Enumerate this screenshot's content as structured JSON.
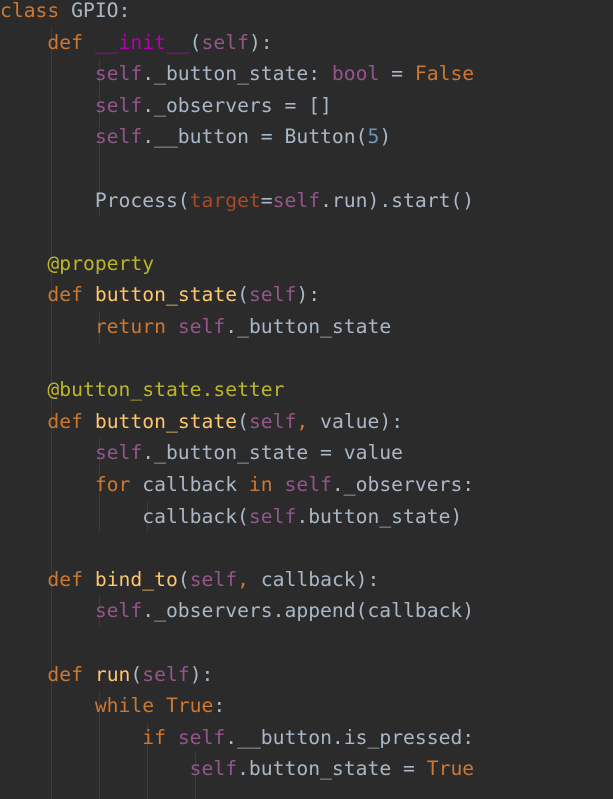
{
  "colors": {
    "background": "#2b2b2b",
    "keyword": "#cc7832",
    "self": "#94558d",
    "function": "#ffc66d",
    "dunder": "#b200b2",
    "decorator": "#bbb529",
    "number": "#6897bb",
    "named_param": "#aa4926",
    "text": "#a9b7c6",
    "indent_guide": "#3b3b3b"
  },
  "lines": [
    [
      [
        "kw",
        "class"
      ],
      [
        "plain",
        " GPIO:"
      ]
    ],
    [
      [
        "plain",
        "    "
      ],
      [
        "kw",
        "def"
      ],
      [
        "plain",
        " "
      ],
      [
        "dunder",
        "__init__"
      ],
      [
        "plain",
        "("
      ],
      [
        "self",
        "self"
      ],
      [
        "plain",
        "):"
      ]
    ],
    [
      [
        "plain",
        "        "
      ],
      [
        "self",
        "self"
      ],
      [
        "plain",
        "._button_state: "
      ],
      [
        "self",
        "bool"
      ],
      [
        "plain",
        " = "
      ],
      [
        "kw",
        "False"
      ]
    ],
    [
      [
        "plain",
        "        "
      ],
      [
        "self",
        "self"
      ],
      [
        "plain",
        "._observers = []"
      ]
    ],
    [
      [
        "plain",
        "        "
      ],
      [
        "self",
        "self"
      ],
      [
        "plain",
        ".__button = Button("
      ],
      [
        "num",
        "5"
      ],
      [
        "plain",
        ")"
      ]
    ],
    [],
    [
      [
        "plain",
        "        Process("
      ],
      [
        "param",
        "target"
      ],
      [
        "plain",
        "="
      ],
      [
        "self",
        "self"
      ],
      [
        "plain",
        ".run).start()"
      ]
    ],
    [],
    [
      [
        "plain",
        "    "
      ],
      [
        "dec",
        "@property"
      ]
    ],
    [
      [
        "plain",
        "    "
      ],
      [
        "kw",
        "def"
      ],
      [
        "plain",
        " "
      ],
      [
        "fn",
        "button_state"
      ],
      [
        "plain",
        "("
      ],
      [
        "self",
        "self"
      ],
      [
        "plain",
        "):"
      ]
    ],
    [
      [
        "plain",
        "        "
      ],
      [
        "kw",
        "return"
      ],
      [
        "plain",
        " "
      ],
      [
        "self",
        "self"
      ],
      [
        "plain",
        "._button_state"
      ]
    ],
    [],
    [
      [
        "plain",
        "    "
      ],
      [
        "dec",
        "@button_state.setter"
      ]
    ],
    [
      [
        "plain",
        "    "
      ],
      [
        "kw",
        "def"
      ],
      [
        "plain",
        " "
      ],
      [
        "fn",
        "button_state"
      ],
      [
        "plain",
        "("
      ],
      [
        "self",
        "self"
      ],
      [
        "kw",
        ","
      ],
      [
        "plain",
        " value):"
      ]
    ],
    [
      [
        "plain",
        "        "
      ],
      [
        "self",
        "self"
      ],
      [
        "plain",
        "._button_state = value"
      ]
    ],
    [
      [
        "plain",
        "        "
      ],
      [
        "kw",
        "for"
      ],
      [
        "plain",
        " callback "
      ],
      [
        "kw",
        "in"
      ],
      [
        "plain",
        " "
      ],
      [
        "self",
        "self"
      ],
      [
        "plain",
        "._observers:"
      ]
    ],
    [
      [
        "plain",
        "            callback("
      ],
      [
        "self",
        "self"
      ],
      [
        "plain",
        ".button_state)"
      ]
    ],
    [],
    [
      [
        "plain",
        "    "
      ],
      [
        "kw",
        "def"
      ],
      [
        "plain",
        " "
      ],
      [
        "fn",
        "bind_to"
      ],
      [
        "plain",
        "("
      ],
      [
        "self",
        "self"
      ],
      [
        "kw",
        ","
      ],
      [
        "plain",
        " callback):"
      ]
    ],
    [
      [
        "plain",
        "        "
      ],
      [
        "self",
        "self"
      ],
      [
        "plain",
        "._observers.append(callback)"
      ]
    ],
    [],
    [
      [
        "plain",
        "    "
      ],
      [
        "kw",
        "def"
      ],
      [
        "plain",
        " "
      ],
      [
        "fn",
        "run"
      ],
      [
        "plain",
        "("
      ],
      [
        "self",
        "self"
      ],
      [
        "plain",
        "):"
      ]
    ],
    [
      [
        "plain",
        "        "
      ],
      [
        "kw",
        "while"
      ],
      [
        "plain",
        " "
      ],
      [
        "kw",
        "True"
      ],
      [
        "plain",
        ":"
      ]
    ],
    [
      [
        "plain",
        "            "
      ],
      [
        "kw",
        "if"
      ],
      [
        "plain",
        " "
      ],
      [
        "self",
        "self"
      ],
      [
        "plain",
        ".__button.is_pressed:"
      ]
    ],
    [
      [
        "plain",
        "                "
      ],
      [
        "self",
        "self"
      ],
      [
        "plain",
        ".button_state = "
      ],
      [
        "kw",
        "True"
      ]
    ]
  ]
}
